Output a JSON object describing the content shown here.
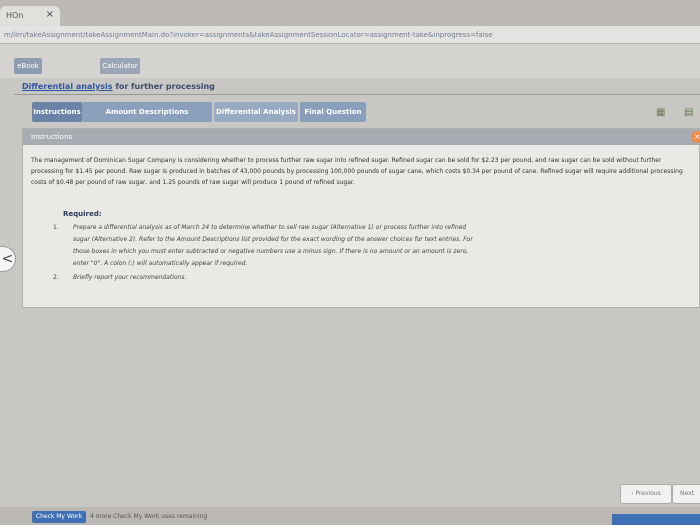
{
  "browser": {
    "tab_label": "HOn",
    "tab_close": "×",
    "address": "m/ilrn/takeAssignment/takeAssignmentMain.do?invoker=assignments&takeAssignmentSessionLocator=assignment-take&inprogress=false"
  },
  "app_tabs": {
    "ebook": "eBook",
    "calculator": "Calculator"
  },
  "page": {
    "title_link": "Differential analysis",
    "title_rest": " for further processing"
  },
  "steps": [
    {
      "label": "Instructions"
    },
    {
      "label": "Amount Descriptions"
    },
    {
      "label": "Differential Analysis"
    },
    {
      "label": "Final Question"
    }
  ],
  "panel": {
    "header": "Instructions",
    "close": "×",
    "body": "The management of Dominican Sugar Company is considering whether to process further raw sugar into refined sugar. Refined sugar can be sold for $2.23 per pound, and raw sugar can be sold without further processing for $1.45 per pound. Raw sugar is produced in batches of 43,000 pounds by processing 100,000 pounds of sugar cane, which costs $0.34 per pound of cane. Refined sugar will require additional processing costs of $0.48 per pound of raw sugar, and 1.25 pounds of raw sugar will produce 1 pound of refined sugar.",
    "required_label": "Required:",
    "requirements": [
      {
        "num": "1.",
        "text": "Prepare a differential analysis as of March 24 to determine whether to sell raw sugar (Alternative 1) or process further into refined sugar (Alternative 2). Refer to the Amount Descriptions list provided for the exact wording of the answer choices for text entries. For those boxes in which you must enter subtracted or negative numbers use a minus sign. If there is no amount or an amount is zero, enter \"0\". A colon (:) will automatically appear if required."
      },
      {
        "num": "2.",
        "text": "Briefly report your recommendations."
      }
    ]
  },
  "nav": {
    "back": "<",
    "previous": "Previous",
    "next": "Next"
  },
  "footer": {
    "check_label": "Check My Work",
    "remaining": "4 more Check My Work uses remaining"
  }
}
